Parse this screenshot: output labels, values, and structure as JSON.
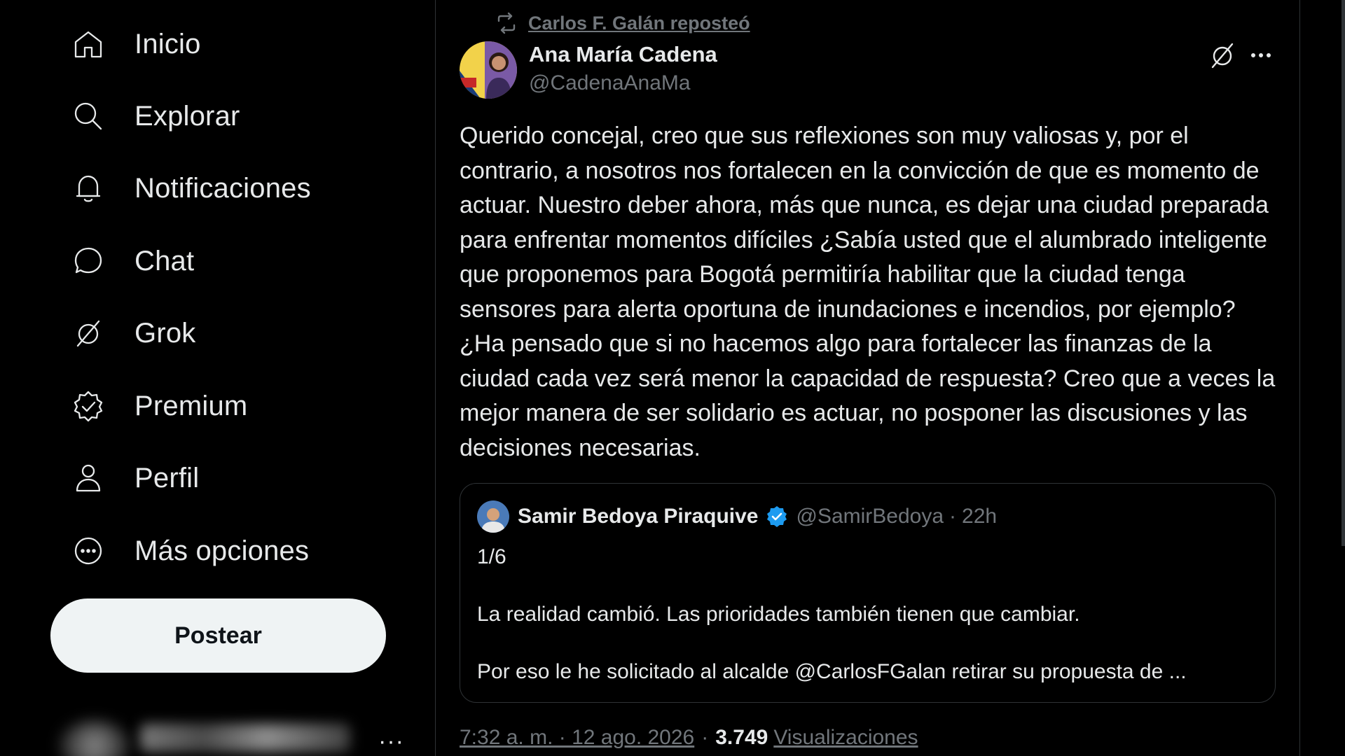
{
  "sidebar": {
    "nav": [
      {
        "label": "Inicio",
        "icon": "home-icon"
      },
      {
        "label": "Explorar",
        "icon": "search-icon"
      },
      {
        "label": "Notificaciones",
        "icon": "bell-icon"
      },
      {
        "label": "Chat",
        "icon": "chat-bubble-icon"
      },
      {
        "label": "Grok",
        "icon": "grok-icon"
      },
      {
        "label": "Premium",
        "icon": "verified-badge-icon"
      },
      {
        "label": "Perfil",
        "icon": "person-icon"
      },
      {
        "label": "Más opciones",
        "icon": "more-circle-icon"
      }
    ],
    "post_button": "Postear",
    "account_more": "···"
  },
  "post": {
    "repost_text": " Carlos F. Galán reposteó",
    "author_name": "Ana María Cadena",
    "author_handle": "@CadenaAnaMa",
    "text": "Querido concejal, creo que sus reflexiones son muy valiosas y, por el contrario, a nosotros nos fortalecen en la convicción de que es momento de actuar. Nuestro deber ahora, más que nunca, es dejar una ciudad preparada para enfrentar momentos difíciles ¿Sabía usted que el alumbrado inteligente que proponemos para Bogotá permitiría habilitar que la ciudad tenga sensores para alerta oportuna de inundaciones e incendios, por ejemplo? ¿Ha pensado que si no hacemos algo para fortalecer las finanzas de la ciudad cada vez será menor la capacidad de respuesta? Creo que a veces la mejor manera de ser solidario es actuar, no posponer las discusiones y las decisiones necesarias.",
    "quote": {
      "name": "Samir Bedoya Piraquive",
      "handle": "@SamirBedoya",
      "separator": "·",
      "time": "22h",
      "line1": "1/6",
      "line2": "La realidad cambió. Las prioridades también tienen que cambiar.",
      "line3": "Por eso le he solicitado al alcalde @CarlosFGalan retirar su propuesta de ..."
    },
    "timestamp": "7:32 a. m. · 12 ago. 2026",
    "meta_separator": "·",
    "views_count": "3.749",
    "views_label": "Visualizaciones"
  },
  "colors": {
    "background": "#000000",
    "text": "#e7e9ea",
    "muted": "#71767b",
    "border": "#2f3336",
    "verified": "#1d9bf0",
    "post_button_bg": "#eff3f4"
  }
}
